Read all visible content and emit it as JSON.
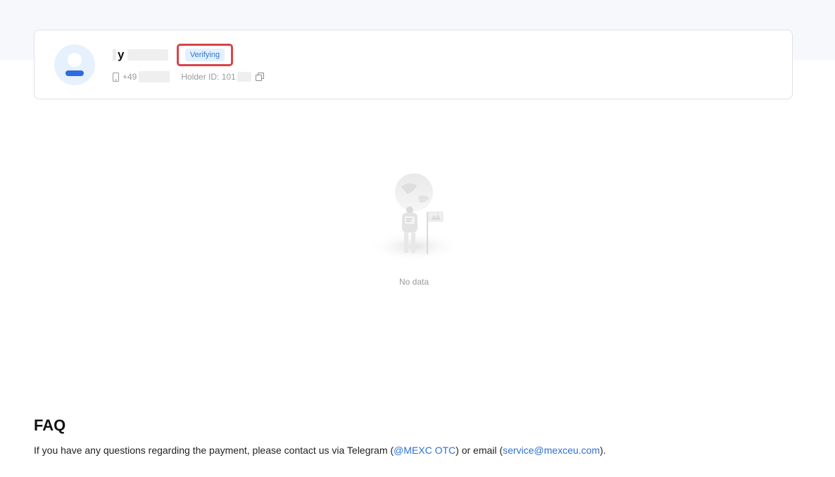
{
  "profile": {
    "name_visible": "y",
    "status": "Verifying",
    "phone_prefix": "+49",
    "holder_label": "Holder ID: 101"
  },
  "empty_state": {
    "message": "No data"
  },
  "faq": {
    "title": "FAQ",
    "text_part1": "If you have any questions regarding the payment, please contact us via Telegram (",
    "telegram_link": "@MEXC OTC",
    "text_part2": ") or email (",
    "email_link": "service@mexceu.com",
    "text_part3": ")."
  },
  "colors": {
    "accent": "#2f73d6",
    "highlight": "#d9434a",
    "badge_bg": "#e3f0ff"
  },
  "icons": {
    "phone": "phone-icon",
    "copy": "copy-icon",
    "avatar": "user-avatar-icon"
  }
}
